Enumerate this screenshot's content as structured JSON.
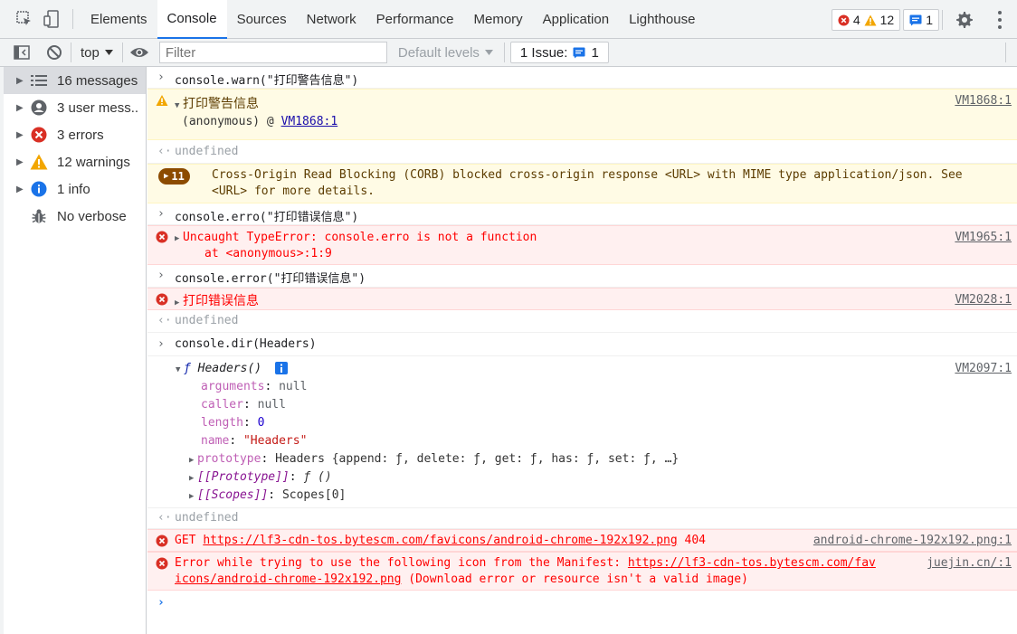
{
  "tabs": [
    "Elements",
    "Console",
    "Sources",
    "Network",
    "Performance",
    "Memory",
    "Application",
    "Lighthouse"
  ],
  "counters": {
    "errors": "4",
    "warnings": "12",
    "info": "1"
  },
  "toolbar": {
    "context": "top",
    "filter_placeholder": "Filter",
    "levels": "Default levels",
    "issues_label": "1 Issue:",
    "issues_count": "1"
  },
  "sidebar": [
    {
      "label": "16 messages",
      "icon": "list-icon"
    },
    {
      "label": "3 user mess...",
      "icon": "user-icon"
    },
    {
      "label": "3 errors",
      "icon": "error-icon"
    },
    {
      "label": "12 warnings",
      "icon": "warning-icon"
    },
    {
      "label": "1 info",
      "icon": "info-icon"
    },
    {
      "label": "No verbose",
      "icon": "bug-icon"
    }
  ],
  "console": {
    "cmd1": "console.warn(\"打印警告信息\")",
    "warn_msg": "打印警告信息",
    "warn_src": "VM1868:1",
    "warn_stack_fn": "(anonymous)",
    "warn_stack_at": "@",
    "warn_stack_link": "VM1868:1",
    "undef1": "undefined",
    "corb_count": "11",
    "corb_line1": "Cross-Origin Read Blocking (CORB) blocked cross-origin response <URL> with MIME type application/json. See",
    "corb_line2": "<URL> for more details.",
    "cmd2": "console.erro(\"打印错误信息\")",
    "err1_msg": "Uncaught TypeError: console.erro is not a function",
    "err1_stack": "at <anonymous>:1:9",
    "err1_src": "VM1965:1",
    "cmd3": "console.error(\"打印错误信息\")",
    "err2_msg": "打印错误信息",
    "err2_src": "VM2028:1",
    "undef2": "undefined",
    "cmd4": "console.dir(Headers)",
    "dir_f": "ƒ",
    "dir_name": "Headers()",
    "dir_src": "VM2097:1",
    "props": {
      "arguments_k": "arguments",
      "arguments_v": "null",
      "caller_k": "caller",
      "caller_v": "null",
      "length_k": "length",
      "length_v": "0",
      "name_k": "name",
      "name_v": "\"Headers\"",
      "prototype_k": "prototype",
      "prototype_v": "Headers {append: ƒ, delete: ƒ, get: ƒ, has: ƒ, set: ƒ, …}",
      "proto_k": "[[Prototype]]",
      "proto_v": "ƒ ()",
      "scopes_k": "[[Scopes]]",
      "scopes_v": "Scopes[0]"
    },
    "undef3": "undefined",
    "get_method": "GET",
    "get_url": "https://lf3-cdn-tos.bytescm.com/favicons/android-chrome-192x192.png",
    "get_status": "404",
    "get_src": "android-chrome-192x192.png:1",
    "manifest_line1_text": "Error while trying to use the following icon from the Manifest:",
    "manifest_line1_url": "https://lf3-cdn-tos.bytescm.com/fav",
    "manifest_line2_url": "icons/android-chrome-192x192.png",
    "manifest_line2_text": "(Download error or resource isn't a valid image)",
    "manifest_src": "juejin.cn/:1"
  }
}
